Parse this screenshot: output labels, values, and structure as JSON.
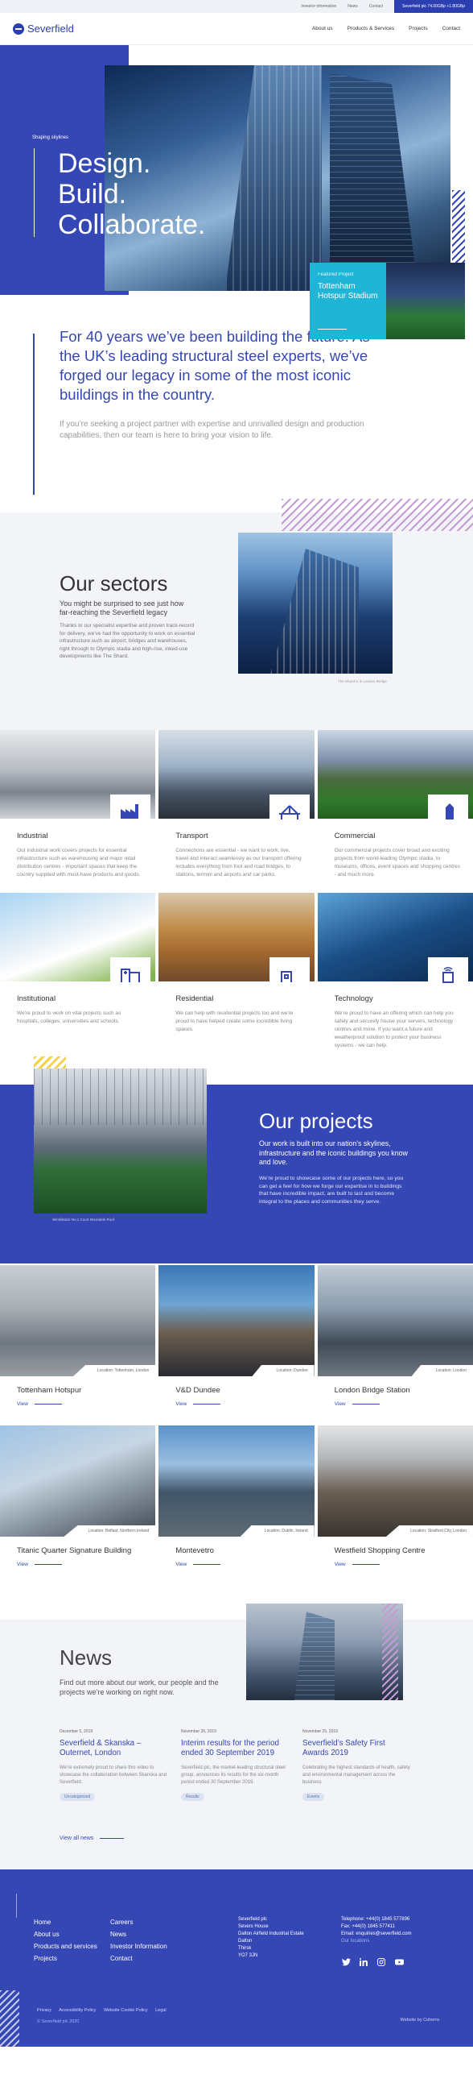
{
  "topbar": {
    "investor": "Investor information",
    "news": "News",
    "contact": "Contact",
    "share": "Severfield plc 74.00GBp +1.80GBp"
  },
  "header": {
    "logo": "Severfield",
    "nav": [
      "About us",
      "Products & Services",
      "Projects",
      "Contact"
    ]
  },
  "hero": {
    "kicker": "Shaping skylines",
    "title_lines": [
      "Design.",
      "Build.",
      "Collaborate."
    ],
    "featured_label": "Featured Project",
    "featured_name": "Tottenham Hotspur Stadium"
  },
  "intro": {
    "heading": "For 40 years we’ve been building the future. As the UK’s leading structural steel experts, we’ve forged our legacy in some of the most iconic buildings in the country.",
    "body": "If you’re seeking a project partner with expertise and unrivalled design and production capabilities, then our team is here to bring your vision to life."
  },
  "sectors": {
    "title": "Our sectors",
    "subtitle": "You might be surprised to see just how far-reaching the Severfield legacy",
    "body": "Thanks to our specialist expertise and proven track-record for delivery, we’ve had the opportunity to work on essential infrastructure such as airport, bridges and warehouses, right through to Olympic stadia and high-rise, inked-use developments like The Shard.",
    "photo_caption": "The Shard is in London Bridge",
    "items": [
      {
        "title": "Industrial",
        "desc": "Our industrial work covers projects for essential infrastructure such as warehousing and major retail distribution centres - important spaces that keep the country supplied with must-have products and goods."
      },
      {
        "title": "Transport",
        "desc": "Connections are essential - we want to work, live, travel and interact seamlessly as our transport offering includes everything from foot and road bridges, to stations, termini and airports and car parks."
      },
      {
        "title": "Commercial",
        "desc": "Our commercial projects cover broad and exciting projects from world-leading Olympic stadia, to museums, offices, event spaces and shopping centres - and much more."
      },
      {
        "title": "Institutional",
        "desc": "We’re proud to work on vital projects such as hospitals, colleges, universities and schools."
      },
      {
        "title": "Residential",
        "desc": "We can help with residential projects too and we’re proud to have helped create some incredible living spaces."
      },
      {
        "title": "Technology",
        "desc": "We’re proud to have an offering which can help you safely and securely house your servers, technology centres and more. If you want a future and weatherproof solution to protect your business systems - we can help."
      }
    ]
  },
  "projects": {
    "title": "Our projects",
    "lead": "Our work is built into our nation’s skylines, infrastructure and the iconic buildings you know and love.",
    "body": "We’re proud to showcase some of our projects here, so you can get a feel for how we forge our expertise in to buildings that have incredible impact, are built to last and become integral to the places and communities they serve.",
    "photo_caption": "Wimbledon No.1 Court Moveable Roof",
    "view_label": "View",
    "items": [
      {
        "title": "Tottenham Hotspur",
        "location": "Location: Tottenham, London"
      },
      {
        "title": "V&D Dundee",
        "location": "Location: Dundee"
      },
      {
        "title": "London Bridge Station",
        "location": "Location: London"
      },
      {
        "title": "Titanic Quarter Signature Building",
        "location": "Location: Belfast, Northern Ireland"
      },
      {
        "title": "Montevetro",
        "location": "Location: Dublin, Ireland"
      },
      {
        "title": "Westfield Shopping Centre",
        "location": "Location: Stratford City, London"
      }
    ]
  },
  "news": {
    "title": "News",
    "subtitle": "Find out more about our work, our people and the projects we’re working on right now.",
    "view_all": "View all news",
    "items": [
      {
        "date": "December 5, 2019",
        "title": "Severfield & Skanska – Outernet, London",
        "desc": "We’re extremely proud to share this video to showcase the collaboration between Skanska and Severfield.",
        "tag": "Uncategorized"
      },
      {
        "date": "November 26, 2019",
        "title": "Interim results for the period ended 30 September 2019",
        "desc": "Severfield plc, the market-leading structural steel group, announces its results for the six-month period ended 30 September 2019.",
        "tag": "Results"
      },
      {
        "date": "November 25, 2019",
        "title": "Severfield’s Safety First Awards 2019",
        "desc": "Celebrating the highest standards of health, safety and environmental management across the business",
        "tag": "Events"
      }
    ]
  },
  "footer": {
    "col1": [
      "Home",
      "About us",
      "Products and services",
      "Projects"
    ],
    "col2": [
      "Careers",
      "News",
      "Investor Information",
      "Contact"
    ],
    "address": [
      "Severfield plc",
      "Severs House",
      "Dalton Airfield Industrial Estate",
      "Dalton",
      "Thirsk",
      "YO7 3JN"
    ],
    "telephone": "Telephone: +44(0) 1845 577896",
    "fax": "Fax: +44(0) 1845 577411",
    "email": "Email: enquiries@severfield.com",
    "linkedin_link": "Our locations",
    "legal": [
      "Privacy",
      "Accessibility Policy",
      "Website Cookie Policy",
      "Legal"
    ],
    "copyright": "© Severfield plc 2020",
    "credit": "Website by Coherra"
  }
}
